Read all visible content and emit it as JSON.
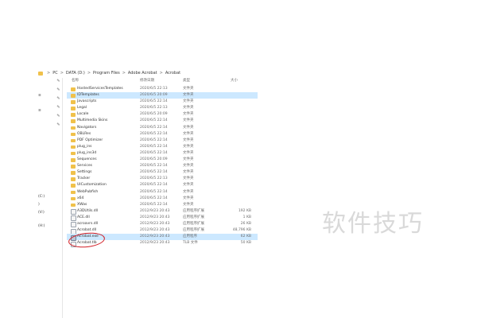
{
  "address": {
    "segments": [
      "PC",
      "DATA (D:)",
      "Program Files",
      "Adobe Acrobat",
      "Acrobat"
    ],
    "separator": ">"
  },
  "columns": {
    "name": "名称",
    "date": "修改日期",
    "type": "类型",
    "size": "大小"
  },
  "left_pane": {
    "drives": [
      "(C:)",
      ")",
      "(V:)",
      "(H:)"
    ]
  },
  "files": [
    {
      "name": "HostedServicesTemplates",
      "date": "2020/6/5 22:13",
      "type": "文件夹",
      "size": "",
      "kind": "folder"
    },
    {
      "name": "IDTemplates",
      "date": "2020/6/5 20:09",
      "type": "文件夹",
      "size": "",
      "kind": "folder",
      "selected": true
    },
    {
      "name": "Javascripts",
      "date": "2020/6/5 22:14",
      "type": "文件夹",
      "size": "",
      "kind": "folder"
    },
    {
      "name": "Legal",
      "date": "2020/6/5 22:13",
      "type": "文件夹",
      "size": "",
      "kind": "folder"
    },
    {
      "name": "Locale",
      "date": "2020/6/5 20:09",
      "type": "文件夹",
      "size": "",
      "kind": "folder"
    },
    {
      "name": "Multimedia Skins",
      "date": "2020/6/5 22:14",
      "type": "文件夹",
      "size": "",
      "kind": "folder"
    },
    {
      "name": "Navigators",
      "date": "2020/6/5 22:14",
      "type": "文件夹",
      "size": "",
      "kind": "folder"
    },
    {
      "name": "OBLRes",
      "date": "2020/6/5 22:14",
      "type": "文件夹",
      "size": "",
      "kind": "folder"
    },
    {
      "name": "PDF Optimizer",
      "date": "2020/6/5 22:14",
      "type": "文件夹",
      "size": "",
      "kind": "folder"
    },
    {
      "name": "plug_ins",
      "date": "2020/6/5 22:14",
      "type": "文件夹",
      "size": "",
      "kind": "folder"
    },
    {
      "name": "plug_ins3d",
      "date": "2020/6/5 22:14",
      "type": "文件夹",
      "size": "",
      "kind": "folder"
    },
    {
      "name": "Sequences",
      "date": "2020/6/5 20:09",
      "type": "文件夹",
      "size": "",
      "kind": "folder"
    },
    {
      "name": "Services",
      "date": "2020/6/5 22:14",
      "type": "文件夹",
      "size": "",
      "kind": "folder"
    },
    {
      "name": "Settings",
      "date": "2020/6/5 22:14",
      "type": "文件夹",
      "size": "",
      "kind": "folder"
    },
    {
      "name": "Tracker",
      "date": "2020/6/5 22:13",
      "type": "文件夹",
      "size": "",
      "kind": "folder"
    },
    {
      "name": "UICustomization",
      "date": "2020/6/5 22:14",
      "type": "文件夹",
      "size": "",
      "kind": "folder"
    },
    {
      "name": "WebPubfish",
      "date": "2020/6/5 22:14",
      "type": "文件夹",
      "size": "",
      "kind": "folder"
    },
    {
      "name": "x64",
      "date": "2020/6/5 22:14",
      "type": "文件夹",
      "size": "",
      "kind": "folder"
    },
    {
      "name": "XWas",
      "date": "2020/6/5 22:14",
      "type": "文件夹",
      "size": "",
      "kind": "folder"
    },
    {
      "name": "A3DUtils.dll",
      "date": "2012/9/23 20:43",
      "type": "应用程序扩展",
      "size": "192 KB",
      "kind": "file"
    },
    {
      "name": "ACE.dll",
      "date": "2012/9/23 20:43",
      "type": "应用程序扩展",
      "size": "1 KB",
      "kind": "file"
    },
    {
      "name": "acroavrs.dll",
      "date": "2012/9/23 20:43",
      "type": "应用程序扩展",
      "size": "26 KB",
      "kind": "file"
    },
    {
      "name": "Acrobat.dll",
      "date": "2012/9/23 20:43",
      "type": "应用程序扩展",
      "size": "48,796 KB",
      "kind": "file"
    },
    {
      "name": "Acrobat.exe",
      "date": "2012/9/23 20:43",
      "type": "应用程序",
      "size": "62 KB",
      "kind": "exe",
      "selected": true
    },
    {
      "name": "Acrobat.tlb",
      "date": "2012/9/23 20:43",
      "type": "TLB 文件",
      "size": "50 KB",
      "kind": "file"
    }
  ],
  "watermark": "软件技巧",
  "colors": {
    "selection": "#cce8ff",
    "annotation": "#d21f26",
    "folder": "#f0c14b"
  }
}
